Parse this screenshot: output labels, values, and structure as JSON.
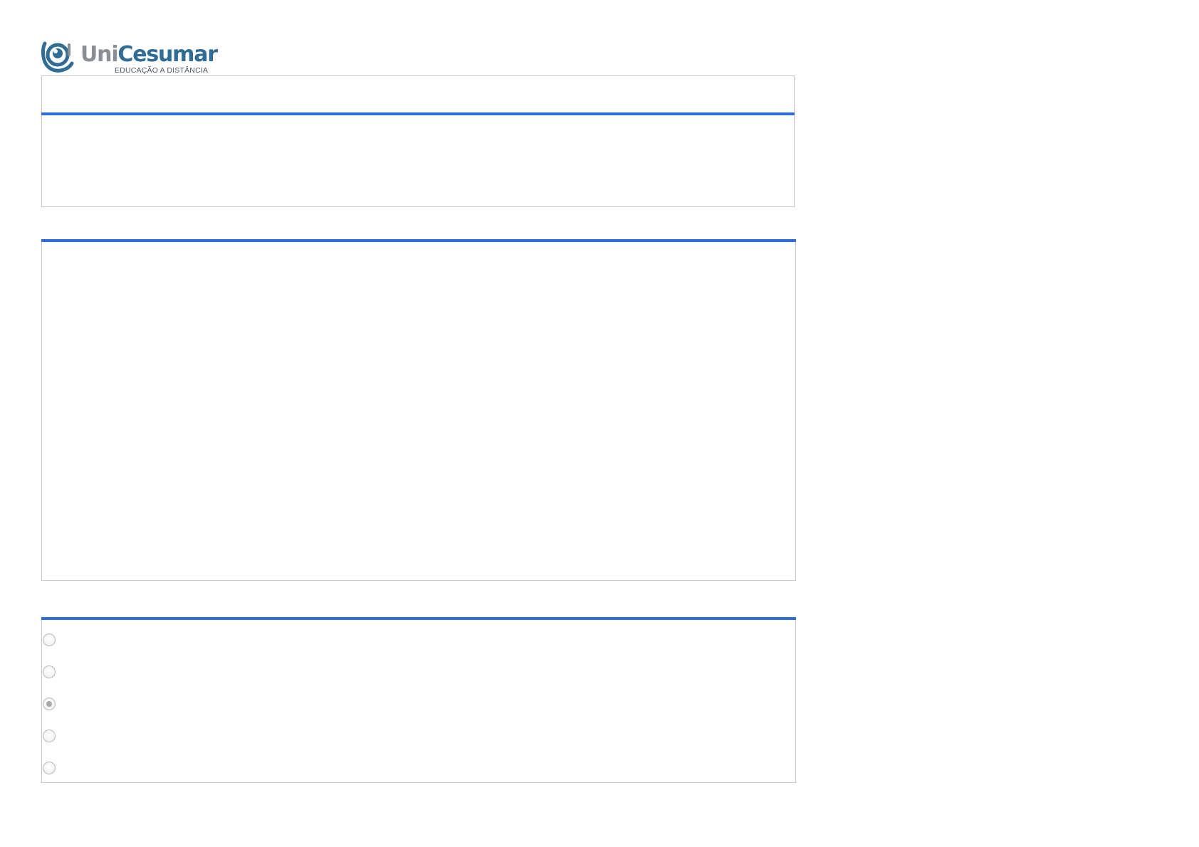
{
  "brand": {
    "name_part1": "Uni",
    "name_part2": "Cesumar",
    "tagline": "EDUCAÇÃO A DISTÂNCIA",
    "colors": {
      "gray": "#8a8f96",
      "blue": "#2f6c96",
      "accent_bar": "#2a6fdb"
    }
  },
  "question_header": {
    "title": "",
    "body": ""
  },
  "question_body": {
    "text": ""
  },
  "answers": {
    "options": [
      {
        "label": "",
        "checked": false
      },
      {
        "label": "",
        "checked": false
      },
      {
        "label": "",
        "checked": true
      },
      {
        "label": "",
        "checked": false
      },
      {
        "label": "",
        "checked": false
      }
    ]
  }
}
